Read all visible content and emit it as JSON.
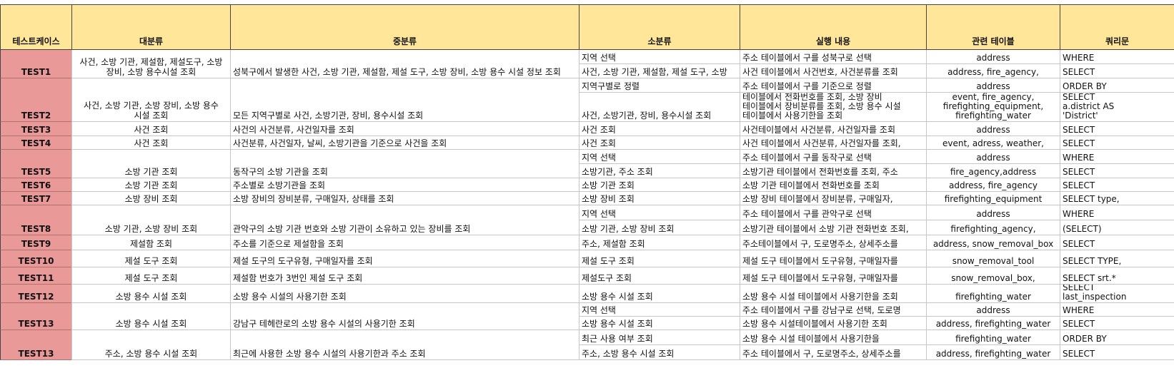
{
  "headers": [
    "테스트케이스",
    "대분류",
    "중분류",
    "소분류",
    "실행 내용",
    "관련 테이블",
    "쿼리문"
  ],
  "rows": [
    {
      "id": "TEST1",
      "major": [
        "사건, 소방 기관, 제설함, 제설도구, 소방",
        "장비, 소방 용수시설 조회"
      ],
      "middle": "성북구에서 발생한 사건, 소방 기관, 제설함, 제설 도구, 소방 장비, 소방 용수 시설 정보 조회",
      "subs": [
        {
          "minor": "지역 선택",
          "action": "주소 테이블에서 구를 성북구로 선택",
          "table": "address",
          "query": "WHERE"
        },
        {
          "minor": "사건, 소방 기관, 제설함, 제설 도구, 소방",
          "action": "사건 테이블에서 사건번호, 사건분류를 조회",
          "table": "address, fire_agency,",
          "query": "SELECT"
        }
      ]
    },
    {
      "id": "TEST2",
      "major": [
        "사건, 소방 기관, 소방 장비, 소방 용수",
        "시설 조회"
      ],
      "middle": "모든 지역구별로 사건, 소방기관, 장비, 용수시설 조회",
      "subs": [
        {
          "minor": "지역구별로 정렬",
          "action": "주소 테이블에서 구를 기준으로 정렬",
          "table": "address",
          "query": "ORDER BY"
        },
        {
          "minor": "사건, 소방기관, 장비, 용수시설 조회",
          "action_lines": [
            "테이블에서 전화번호를 조회, 소방 장비",
            "테이블에서 장비분류를 조회, 소방 용수 시설",
            "테이블에서 사용기한을 조회"
          ],
          "table_lines": [
            "event, fire_agency,",
            "firefighting_equipment,",
            "firefighting_water"
          ],
          "query_lines": [
            "SELECT",
            "a.district AS",
            "'District'"
          ]
        }
      ]
    },
    {
      "id": "TEST3",
      "major": [
        "사건 조회"
      ],
      "middle": "사건의 사건분류, 사건일자를 조회",
      "subs": [
        {
          "minor": "사건 조회",
          "action": "사건테이블에서 사건분류, 사건일자를 조회",
          "table": "address",
          "query": "SELECT"
        }
      ]
    },
    {
      "id": "TEST4",
      "major": [
        "사건 조회"
      ],
      "middle": "사건분류, 사건일자, 날씨, 소방기관을 기준으로 사건을 조회",
      "subs": [
        {
          "minor": "사건 조회",
          "action": "사건 테이블에서 사건분류, 사건일자를 조회,",
          "table": "event, adress, weather,",
          "query": "SELECT"
        }
      ]
    },
    {
      "id": "TEST5",
      "major": [
        "소방 기관 조회"
      ],
      "middle": "동작구의 소방 기관을 조회",
      "subs": [
        {
          "minor": "지역 선택",
          "action": "주소 테이블에서 구를 동작구로 선택",
          "table": "address",
          "query": "WHERE"
        },
        {
          "minor": "소방기관, 주소 조회",
          "action": "소방기관 테이블에서 전화번호를 조회, 주소",
          "table": "fire_agency,address",
          "query": "SELECT"
        }
      ]
    },
    {
      "id": "TEST6",
      "major": [
        "소방 기관 조회"
      ],
      "middle": "주소별로 소방기관을 조회",
      "subs": [
        {
          "minor": "소방 기관 조회",
          "action": "소방 기관 테이블에서 전화번호를 조회",
          "table": "address, fire_agency",
          "query": "SELECT"
        }
      ]
    },
    {
      "id": "TEST7",
      "major": [
        "소방 장비 조회"
      ],
      "middle": "소방 장비의 장비분류, 구매일자, 상태를 조회",
      "subs": [
        {
          "minor": "소방 장비 조회",
          "action": "소방 장비 테이블에서 장비분류, 구매일자,",
          "table": "firefighting_equipment",
          "query": "SELECT type,"
        }
      ]
    },
    {
      "id": "TEST8",
      "major": [
        "소방 기관, 소방 장비 조회"
      ],
      "middle": "관악구의 소방 기관 번호와 소방 기관이 소유하고 있는 장비를 조회",
      "subs": [
        {
          "minor": "지역 선택",
          "action": "주소 테이블에서 구를 관악구로 선택",
          "table": "address",
          "query": "WHERE"
        },
        {
          "minor": "소방 기관, 소방 장비 조회",
          "action": "소방기관 테이블에서 소방 기관 전화번호 조회,",
          "table": "firefighting_agency,",
          "query": "(SELECT)"
        }
      ]
    },
    {
      "id": "TEST9",
      "major": [
        "제설함 조회"
      ],
      "middle": "주소를 기준으로 제설함을 조회",
      "subs": [
        {
          "minor": "주소, 제설함 조회",
          "action": "주소테이블에서 구, 도로명주소, 상세주소를",
          "table": "address, snow_removal_box",
          "query": "SELECT"
        }
      ]
    },
    {
      "id": "TEST10",
      "major": [
        "제설 도구 조회"
      ],
      "middle": "제설 도구의 도구유형, 구매일자를 조회",
      "subs": [
        {
          "minor": "제설 도구 조회",
          "action": "제설 도구 테이블에서 도구유형, 구매일자를",
          "table": "snow_removal_tool",
          "query": "SELECT TYPE,"
        }
      ]
    },
    {
      "id": "TEST11",
      "major": [
        "제설 도구 조회"
      ],
      "middle": "제설함 번호가 3번인 제설 도구 조회",
      "subs": [
        {
          "minor": "제설도구 조회",
          "action": "제설 도구 테이블에서 도구유형, 구매일자를",
          "table": "snow_removal_box,",
          "query": "SELECT srt.*"
        }
      ]
    },
    {
      "id": "TEST12",
      "major": [
        "소방 용수 시설 조회"
      ],
      "middle": "소방 용수 시설의 사용기한 조회",
      "subs": [
        {
          "minor": "소방 용수 시설 조회",
          "action": "소방 용수 시설 테이블에서 사용기한을 조회",
          "table": "firefighting_water",
          "query_lines": [
            "SELECT",
            "last_inspection"
          ]
        }
      ]
    },
    {
      "id": "TEST13",
      "major": [
        "소방 용수 시설 조회"
      ],
      "middle": "강남구 테헤란로의 소방 용수 시설의 사용기한 조회",
      "subs": [
        {
          "minor": "지역 선택",
          "action": "주소 테이블에서 구를 강남구로 선택, 도로명",
          "table": "address",
          "query": "WHERE"
        },
        {
          "minor": "소방 용수 시설 조회",
          "action": "소방 용수 시설테이블에서 사용기한 조회",
          "table": "address, firefighting_water",
          "query": "SELECT"
        }
      ]
    },
    {
      "id": "TEST13",
      "major": [
        "주소, 소방 용수 시설 조회"
      ],
      "middle": "최근에 사용한 소방 용수 시설의 사용기한과 주소 조회",
      "subs": [
        {
          "minor": "최근 사용 여부 조회",
          "action": "소방 용수 시설 테이블에서 사용기한을",
          "table": "firefighting_water",
          "query": "ORDER BY"
        },
        {
          "minor": "주소, 소방 용수 시설 조회",
          "action": "주소 테이블에서 구, 도로명주소, 상세주소를",
          "table": "address, firefighting_water",
          "query": "SELECT"
        }
      ]
    }
  ]
}
